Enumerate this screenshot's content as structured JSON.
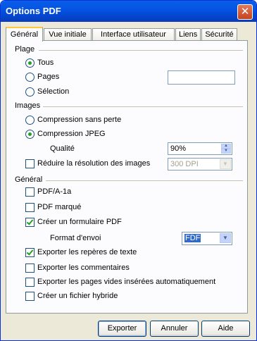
{
  "window": {
    "title": "Options PDF",
    "close_symbol": "✕"
  },
  "tabs": [
    {
      "label": "Général",
      "active": true
    },
    {
      "label": "Vue initiale"
    },
    {
      "label": "Interface utilisateur"
    },
    {
      "label": "Liens"
    },
    {
      "label": "Sécurité"
    }
  ],
  "plage": {
    "title": "Plage",
    "tous": "Tous",
    "pages": "Pages",
    "pages_value": "",
    "selection": "Sélection"
  },
  "images": {
    "title": "Images",
    "sans_perte": "Compression sans perte",
    "jpeg": "Compression JPEG",
    "qualite_label": "Qualité",
    "qualite_value": "90%",
    "reduire": "Réduire la résolution des images",
    "dpi_value": "300 DPI"
  },
  "general": {
    "title": "Général",
    "pdfa": "PDF/A-1a",
    "marque": "PDF marqué",
    "formulaire": "Créer un formulaire PDF",
    "format_label": "Format d'envoi",
    "format_value": "FDF",
    "reperes": "Exporter les repères de texte",
    "commentaires": "Exporter les commentaires",
    "pages_vides": "Exporter les pages vides insérées automatiquement",
    "hybride": "Créer un fichier hybride"
  },
  "buttons": {
    "exporter": "Exporter",
    "annuler": "Annuler",
    "aide": "Aide"
  },
  "colors": {
    "titlebar": "#0554e3",
    "dialog_bg": "#ece9d8",
    "check_green": "#21a121",
    "selection_blue": "#316ac5"
  },
  "state": {
    "range": "tous",
    "compression": "jpeg",
    "reduire_checked": false,
    "pdfa_checked": false,
    "marque_checked": false,
    "formulaire_checked": true,
    "reperes_checked": true,
    "commentaires_checked": false,
    "pages_vides_checked": false,
    "hybride_checked": false
  }
}
